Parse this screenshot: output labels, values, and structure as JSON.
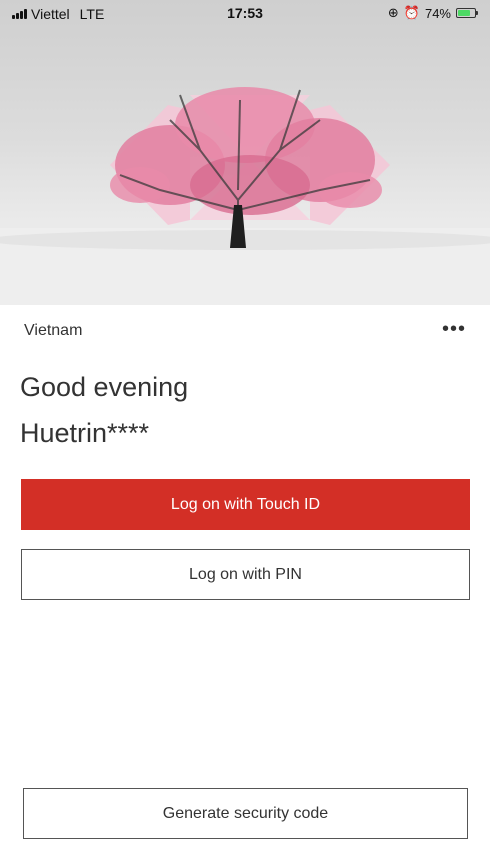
{
  "status_bar": {
    "carrier": "Viettel",
    "network": "LTE",
    "time": "17:53",
    "battery_percent": "74%",
    "battery_level": 0.74
  },
  "hero": {
    "image": "snowy-tree-with-pink-blossoms-hexagon-logo",
    "accent_color": "#e88aa8"
  },
  "region": {
    "label": "Vietnam",
    "more_icon": "more-dots-icon"
  },
  "greeting": {
    "salutation": "Good evening",
    "username": "Huetrin****"
  },
  "actions": {
    "touch_id_label": "Log on with Touch ID",
    "pin_label": "Log on with PIN",
    "security_code_label": "Generate security code"
  },
  "colors": {
    "primary": "#d32f26",
    "text": "#333333",
    "border": "#555555"
  }
}
